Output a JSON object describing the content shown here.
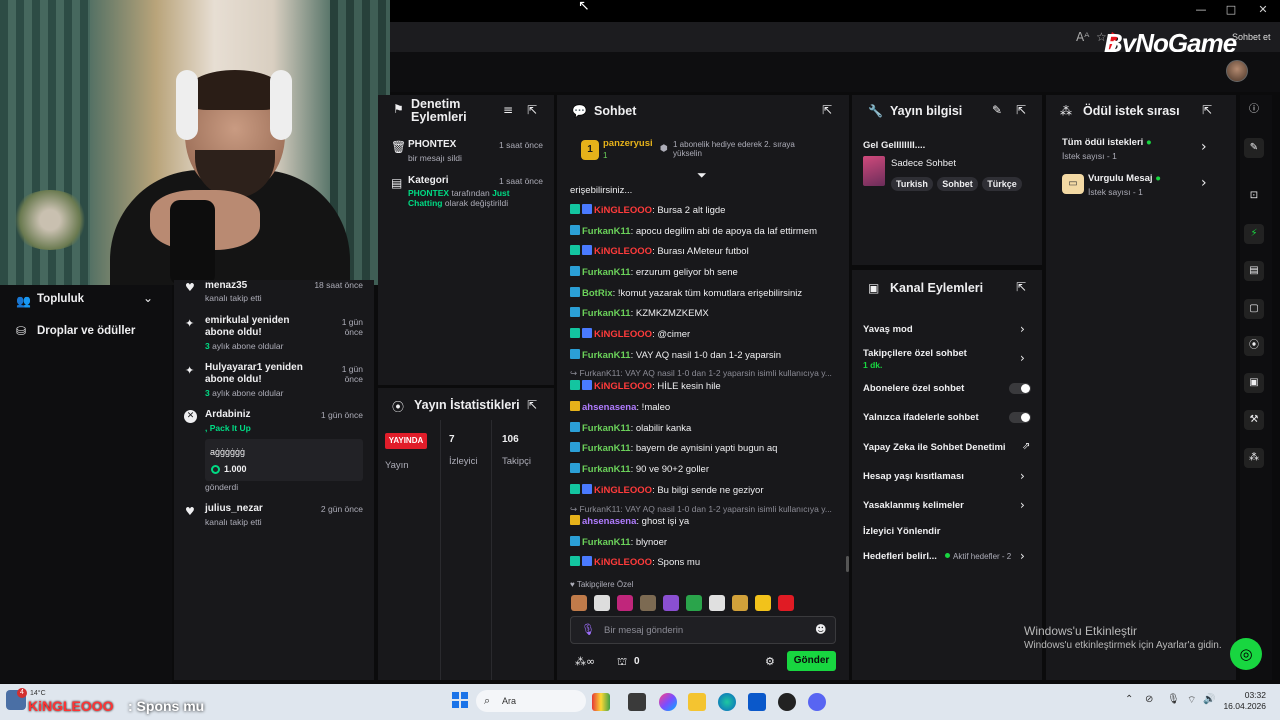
{
  "browser": {
    "brand": "ByNoGame",
    "chat_label": "Sohbet et",
    "win_min": "—",
    "win_max": "□",
    "win_close": "✕"
  },
  "nav": {
    "items": [
      {
        "label": "Topluluk"
      },
      {
        "label": "Droplar ve ödüller"
      }
    ]
  },
  "activity": {
    "items": [
      {
        "name": "menaz35",
        "sub": "kanalı takip etti",
        "time": "18 saat önce"
      },
      {
        "name": "emirkulal yeniden abone oldu!",
        "months": "3",
        "sub": "aylık abone oldular",
        "time": "1 gün önce"
      },
      {
        "name": "Hulyayarar1 yeniden abone oldu!",
        "months": "3",
        "sub": "aylık abone oldular",
        "time": "1 gün önce"
      },
      {
        "name": "Ardabiniz",
        "gift": ", Pack It Up",
        "gift_box_title": "aġġġġġġ",
        "gift_box_amount": "1.000",
        "sub": "gönderdi",
        "time": "1 gün önce"
      },
      {
        "name": "julius_nezar",
        "sub": "kanalı takip etti",
        "time": "2 gün önce"
      }
    ]
  },
  "mod": {
    "title": "Denetim Eylemleri",
    "items": [
      {
        "user": "PHONTEX",
        "desc": "bir mesajı sildi",
        "time": "1 saat önce"
      },
      {
        "user": "Kategori",
        "actor": "PHONTEX",
        "desc_a": " tarafından ",
        "cat": "Just Chatting",
        "desc_b": " olarak değiştirildi",
        "time": "1 saat önce"
      }
    ]
  },
  "stats": {
    "title": "Yayın İstatistikleri",
    "live_label": "YAYINDA",
    "col1_label": "Yayın",
    "viewers": "7",
    "viewers_label": "İzleyici",
    "followers": "106",
    "followers_label": "Takipçi"
  },
  "chat": {
    "title": "Sohbet",
    "pinned_user": "panzeryusi",
    "pinned_count": "1",
    "pinned_rank": "1",
    "pinned_text": "1 abonelik hediye ederek 2. sıraya yükselin",
    "lines": [
      {
        "type": "plain",
        "text": "erişebilirsiniz..."
      },
      {
        "type": "msg",
        "user": "KiNGLEOOO",
        "color": "red",
        "text": ": Bursa 2 alt ligde"
      },
      {
        "type": "msg",
        "user": "FurkanK11",
        "color": "green",
        "text": ": apocu degilim abi de apoya da laf ettirmem"
      },
      {
        "type": "msg",
        "user": "KiNGLEOOO",
        "color": "red",
        "text": ": Burası AMeteur futbol"
      },
      {
        "type": "msg",
        "user": "FurkanK11",
        "color": "green",
        "text": ": erzurum geliyor bh sene"
      },
      {
        "type": "msg",
        "user": "BotRix",
        "color": "green",
        "text": ": !komut yazarak tüm komutlara erişebilirsiniz"
      },
      {
        "type": "msg",
        "user": "FurkanK11",
        "color": "green",
        "text": ": KZMKZMZKEMX"
      },
      {
        "type": "msg",
        "user": "KiNGLEOOO",
        "color": "red",
        "text": ": @cimer"
      },
      {
        "type": "msg",
        "user": "FurkanK11",
        "color": "green",
        "text": ": VAY AQ nasil 1-0 dan 1-2 yaparsin"
      },
      {
        "type": "reply",
        "text": "↪ FurkanK11: VAY AQ nasil 1-0 dan 1-2 yaparsin isimli kullanıcıya y..."
      },
      {
        "type": "msg",
        "user": "KiNGLEOOO",
        "color": "red",
        "text": ": HİLE kesin hile"
      },
      {
        "type": "msg",
        "user": "ahsenasena",
        "color": "purple",
        "text": ": !maleo"
      },
      {
        "type": "msg",
        "user": "FurkanK11",
        "color": "green",
        "text": ": olabilir kanka"
      },
      {
        "type": "msg",
        "user": "FurkanK11",
        "color": "green",
        "text": ": bayern de aynisini yapti bugun aq"
      },
      {
        "type": "msg",
        "user": "FurkanK11",
        "color": "green",
        "text": ": 90 ve 90+2 goller"
      },
      {
        "type": "msg",
        "user": "KiNGLEOOO",
        "color": "red",
        "text": ": Bu bilgi sende ne geziyor"
      },
      {
        "type": "reply",
        "text": "↪ FurkanK11: VAY AQ nasil 1-0 dan 1-2 yaparsin isimli kullanıcıya y..."
      },
      {
        "type": "msg",
        "user": "ahsenasena",
        "color": "purple",
        "text": ": ghost işi ya"
      },
      {
        "type": "msg",
        "user": "FurkanK11",
        "color": "green",
        "text": ": blynoer"
      },
      {
        "type": "msg",
        "user": "KiNGLEOOO",
        "color": "red",
        "text": ": Spons mu"
      }
    ],
    "follower_only": "Takipçilere Özel",
    "input_placeholder": "Bir mesaj gönderin",
    "points": "0",
    "send_label": "Gönder"
  },
  "info": {
    "title": "Yayın bilgisi",
    "stream_title": "Gel Gellllllll....",
    "category": "Sadece Sohbet",
    "tags": [
      "Turkish",
      "Sohbet",
      "Türkçe"
    ]
  },
  "chan": {
    "title": "Kanal Eylemleri",
    "slow": "Yavaş mod",
    "follower": "Takipçilere özel sohbet",
    "follower_time": "1 dk.",
    "sub": "Abonelere özel sohbet",
    "emote": "Yalnızca ifadelerle sohbet",
    "ai": "Yapay Zeka ile Sohbet Denetimi",
    "age": "Hesap yaşı kısıtlaması",
    "banned": "Yasaklanmış kelimeler",
    "redirect": "İzleyici Yönlendir",
    "goals": "Hedefleri belirl...",
    "goals_active": "Aktif hedefler - 2"
  },
  "reward": {
    "title": "Ödül istek sırası",
    "items": [
      {
        "title": "Tüm ödül istekleri",
        "sub": "İstek sayısı - 1"
      },
      {
        "title": "Vurgulu Mesaj",
        "sub": "İstek sayısı - 1"
      }
    ]
  },
  "watermark": {
    "title": "Windows'u Etkinleştir",
    "sub": "Windows'u etkinleştirmek için Ayarlar'a gidin."
  },
  "taskbar": {
    "search": "Ara",
    "time": "03:32",
    "date": "16.04.2026",
    "temp": "14°C",
    "notif": "4"
  },
  "overlay": {
    "user": "KiNGLEOOO",
    "msg": ": Spons mu"
  }
}
